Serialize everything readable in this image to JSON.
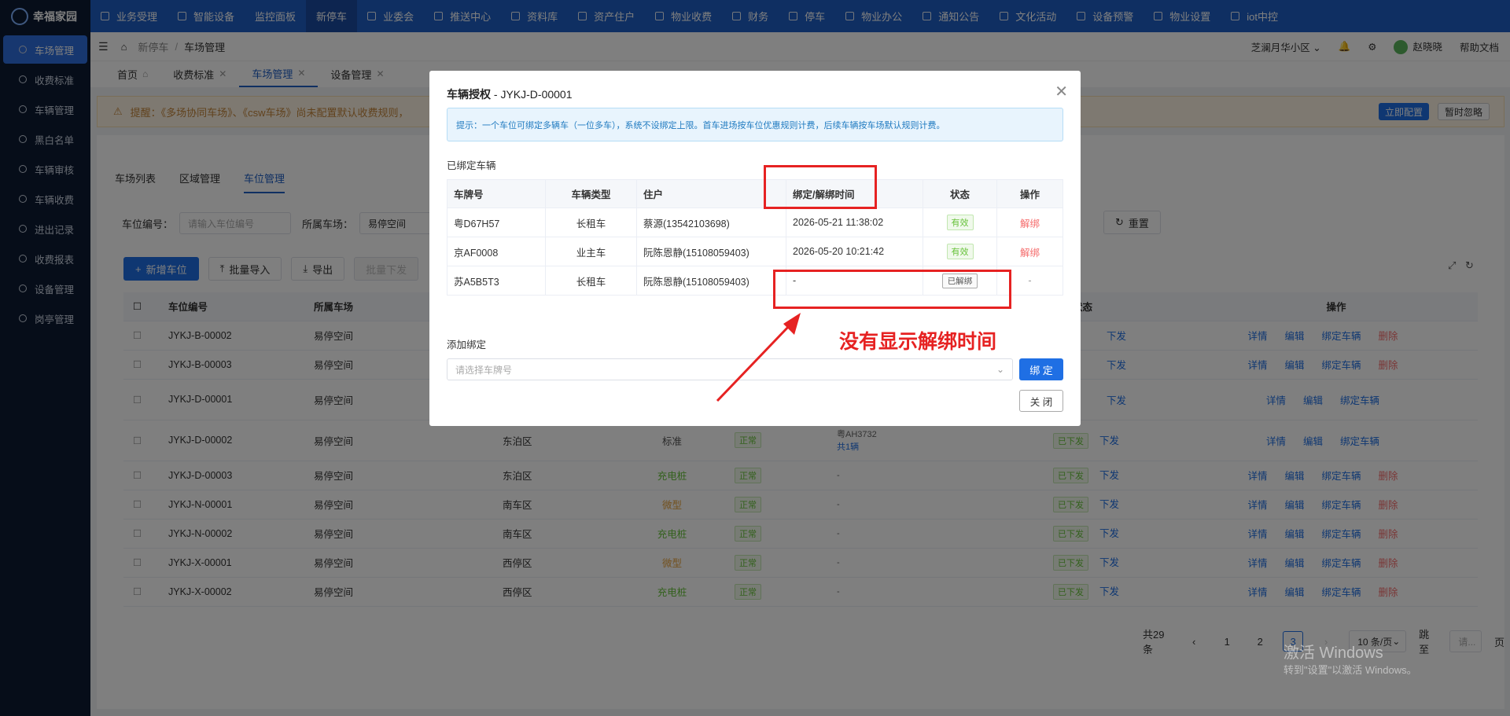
{
  "app": {
    "logo": "幸福家园"
  },
  "topnav": [
    {
      "label": "业务受理"
    },
    {
      "label": "智能设备"
    },
    {
      "label": "监控面板"
    },
    {
      "label": "新停车"
    },
    {
      "label": "业委会"
    },
    {
      "label": "推送中心"
    },
    {
      "label": "资料库"
    },
    {
      "label": "资产住户"
    },
    {
      "label": "物业收费"
    },
    {
      "label": "财务"
    },
    {
      "label": "停车"
    },
    {
      "label": "物业办公"
    },
    {
      "label": "通知公告"
    },
    {
      "label": "文化活动"
    },
    {
      "label": "设备预警"
    },
    {
      "label": "物业设置"
    },
    {
      "label": "iot中控"
    }
  ],
  "sidebar": [
    {
      "label": "车场管理"
    },
    {
      "label": "收费标准"
    },
    {
      "label": "车辆管理"
    },
    {
      "label": "黑白名单"
    },
    {
      "label": "车辆审核"
    },
    {
      "label": "车辆收费"
    },
    {
      "label": "进出记录"
    },
    {
      "label": "收费报表"
    },
    {
      "label": "设备管理"
    },
    {
      "label": "岗亭管理"
    }
  ],
  "breadcrumb": {
    "parent": "新停车",
    "current": "车场管理"
  },
  "header_right": {
    "community": "芝澜月华小区",
    "user": "赵晓晓",
    "help": "帮助文档"
  },
  "tabs": [
    {
      "label": "首页"
    },
    {
      "label": "收费标准"
    },
    {
      "label": "车场管理"
    },
    {
      "label": "设备管理"
    }
  ],
  "warning": {
    "text": "提醒：《多场协同车场》、《csw车场》尚未配置默认收费规则，",
    "btn_config": "立即配置",
    "btn_ignore": "暂时忽略"
  },
  "subtabs": [
    {
      "label": "车场列表"
    },
    {
      "label": "区域管理"
    },
    {
      "label": "车位管理"
    }
  ],
  "filter": {
    "slot_label": "车位编号：",
    "slot_placeholder": "请输入车位编号",
    "lot_label": "所属车场：",
    "lot_value": "易停空间",
    "reset": "重置"
  },
  "actions": {
    "add": "新增车位",
    "import": "批量导入",
    "export": "导出",
    "issue": "批量下发"
  },
  "bg_table": {
    "headers": [
      "车位编号",
      "所属车场",
      "",
      "",
      "",
      "",
      "同步状态",
      "操作"
    ],
    "rows": [
      {
        "code": "JYKJ-B-00002",
        "lot": "易停空间",
        "area": "",
        "type": "",
        "status": "",
        "car": "",
        "sync": "下发"
      },
      {
        "code": "JYKJ-B-00003",
        "lot": "易停空间",
        "area": "",
        "type": "",
        "status": "",
        "car": "",
        "sync": "下发"
      },
      {
        "code": "JYKJ-D-00001",
        "lot": "易停空间",
        "area": "",
        "type": "",
        "status": "",
        "car": "",
        "sync": "下发"
      },
      {
        "code": "JYKJ-D-00002",
        "lot": "易停空间",
        "area": "东泊区",
        "type": "标准",
        "status": "正常",
        "car": "粤AH3732",
        "car_count": "共1辆",
        "sync": "已下发",
        "sync_btn": "下发"
      },
      {
        "code": "JYKJ-D-00003",
        "lot": "易停空间",
        "area": "东泊区",
        "type": "充电桩",
        "status": "正常",
        "car": "-",
        "sync": "已下发",
        "sync_btn": "下发"
      },
      {
        "code": "JYKJ-N-00001",
        "lot": "易停空间",
        "area": "南车区",
        "type": "微型",
        "status": "正常",
        "car": "-",
        "sync": "已下发",
        "sync_btn": "下发"
      },
      {
        "code": "JYKJ-N-00002",
        "lot": "易停空间",
        "area": "南车区",
        "type": "充电桩",
        "status": "正常",
        "car": "-",
        "sync": "已下发",
        "sync_btn": "下发"
      },
      {
        "code": "JYKJ-X-00001",
        "lot": "易停空间",
        "area": "西停区",
        "type": "微型",
        "status": "正常",
        "car": "-",
        "sync": "已下发",
        "sync_btn": "下发"
      },
      {
        "code": "JYKJ-X-00002",
        "lot": "易停空间",
        "area": "西停区",
        "type": "充电桩",
        "status": "正常",
        "car": "-",
        "sync": "已下发",
        "sync_btn": "下发"
      }
    ],
    "op": {
      "detail": "详情",
      "edit": "编辑",
      "bind": "绑定车辆",
      "del": "删除"
    }
  },
  "pager": {
    "total": "共29条",
    "pages": [
      "1",
      "2",
      "3"
    ],
    "current": "3",
    "size": "10 条/页",
    "jump": "跳至",
    "page": "页"
  },
  "modal": {
    "title": "车辆授权",
    "title_code": "JYKJ-D-00001",
    "tip": "提示：一个车位可绑定多辆车（一位多车），系统不设绑定上限。首车进场按车位优惠规则计费，后续车辆按车场默认规则计费。",
    "bound_title": "已绑定车辆",
    "headers": [
      "车牌号",
      "车辆类型",
      "住户",
      "绑定/解绑时间",
      "状态",
      "操作"
    ],
    "rows": [
      {
        "plate": "粤D67H57",
        "type": "长租车",
        "owner": "蔡源(13542103698)",
        "time": "2026-05-21 11:38:02",
        "status": "有效",
        "op": "解绑"
      },
      {
        "plate": "京AF0008",
        "type": "业主车",
        "owner": "阮陈恩静(15108059403)",
        "time": "2026-05-20 10:21:42",
        "status": "有效",
        "op": "解绑"
      },
      {
        "plate": "苏A5B5T3",
        "type": "长租车",
        "owner": "阮陈恩静(15108059403)",
        "time": "-",
        "status": "已解绑",
        "op": "-"
      }
    ],
    "add_title": "添加绑定",
    "select_placeholder": "请选择车牌号",
    "bind_btn": "绑 定",
    "close_btn": "关 闭"
  },
  "annotation": "没有显示解绑时间",
  "windows": {
    "line1": "激活 Windows",
    "line2": "转到\"设置\"以激活 Windows。"
  }
}
